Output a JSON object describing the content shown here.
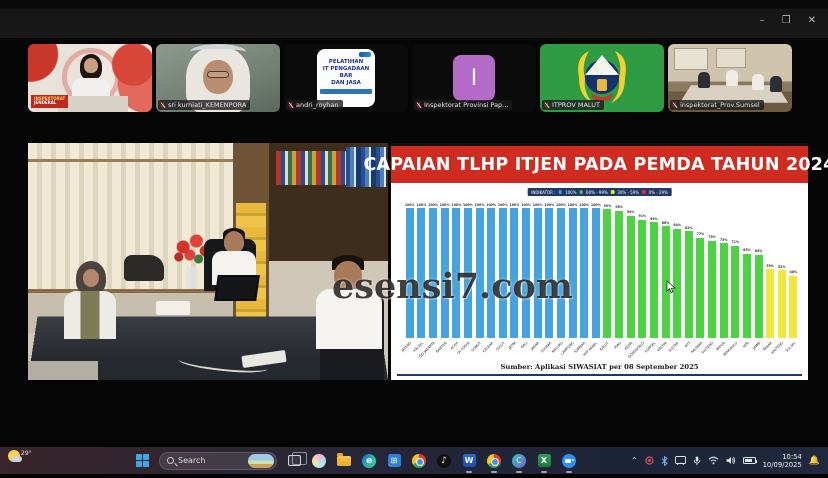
{
  "window": {
    "controls": {
      "minimize": "–",
      "maximize": "❐",
      "close": "✕"
    }
  },
  "participants": [
    {
      "name": "",
      "overlay_logo_line1": "INSPEKTORAT",
      "overlay_logo_line2": "JENDERAL"
    },
    {
      "name": "sri kurniati_KEMENPORA",
      "mic": "muted"
    },
    {
      "name": "andri_royhan",
      "mic": "muted",
      "slide_text": {
        "line1": "PELATIHAN",
        "line2": "IT PENGADAAN BAR",
        "line3": "DAN JASA"
      }
    },
    {
      "name": "Inspektorat Provinsi Pap...",
      "mic": "muted",
      "initial": "I"
    },
    {
      "name": "ITPROV MALUT",
      "mic": "muted"
    },
    {
      "name": "inspektorat_Prov.Sumsel",
      "mic": "muted"
    }
  ],
  "slide": {
    "title": "CAPAIAN TLHP ITJEN PADA PEMDA TAHUN 2024",
    "legend": {
      "label": "INDIKATOR :",
      "items": [
        {
          "color": "#45a3dd",
          "label": "100%"
        },
        {
          "color": "#4cd243",
          "label": "60% - 99%"
        },
        {
          "color": "#f2e53c",
          "label": "30% - 59%"
        },
        {
          "color": "#e03030",
          "label": "0% - 29%"
        }
      ]
    },
    "footer": "Sumber: Aplikasi SIWASIAT per 08 September 2025",
    "banner_color": "#d02b20",
    "accent_navy": "#1f3864"
  },
  "chart_data": {
    "type": "bar",
    "title": "CAPAIAN TLHP ITJEN PADA PEMDA TAHUN 2024",
    "ylim": [
      0,
      100
    ],
    "value_suffix": "%",
    "grid": false,
    "legend_position": "top",
    "categories": [
      "JATENG",
      "KALSEL",
      "DKI JAKARTA",
      "BANTEN",
      "ACEH",
      "DI YOGYA",
      "SUMUT",
      "KALBAR",
      "SULUT",
      "JATIM",
      "BALI",
      "JABAR",
      "SULBAR",
      "MALUKU",
      "LAMPUNG",
      "SUMBAR",
      "KEP BABEL",
      "KALUT",
      "RIAU",
      "KEPRI",
      "GORONTALO",
      "SUMSEL",
      "KALTIM",
      "SULTRA",
      "NTT",
      "KALTARA",
      "SULTENG",
      "PAPUA",
      "BENGKULU",
      "NTB",
      "JAMBI",
      "PABAR",
      "KALTENG",
      "SULSEL"
    ],
    "values": [
      100,
      100,
      100,
      100,
      100,
      100,
      100,
      100,
      100,
      100,
      100,
      100,
      100,
      100,
      100,
      100,
      100,
      99,
      98,
      94,
      91,
      89,
      86,
      84,
      82,
      77,
      75,
      73,
      71,
      65,
      64,
      53,
      52,
      48
    ],
    "bar_colors": [
      "#45a3dd",
      "#45a3dd",
      "#45a3dd",
      "#45a3dd",
      "#45a3dd",
      "#45a3dd",
      "#45a3dd",
      "#45a3dd",
      "#45a3dd",
      "#45a3dd",
      "#45a3dd",
      "#45a3dd",
      "#45a3dd",
      "#45a3dd",
      "#45a3dd",
      "#45a3dd",
      "#45a3dd",
      "#4cd243",
      "#4cd243",
      "#4cd243",
      "#4cd243",
      "#4cd243",
      "#4cd243",
      "#4cd243",
      "#4cd243",
      "#4cd243",
      "#4cd243",
      "#4cd243",
      "#4cd243",
      "#4cd243",
      "#4cd243",
      "#f2e53c",
      "#f2e53c",
      "#f2e53c"
    ]
  },
  "watermark": {
    "text": "esensi7.com"
  },
  "taskbar": {
    "weather": {
      "temp": "29°"
    },
    "search": {
      "label": "Search"
    },
    "icons": [
      "start",
      "search",
      "task-view",
      "copilot",
      "file-explorer",
      "edge",
      "store",
      "chrome",
      "tiktok",
      "word",
      "chrome",
      "canva",
      "excel",
      "zoom"
    ],
    "tray_icons": [
      "chevron-up",
      "record",
      "bluetooth",
      "cast",
      "microphone",
      "wifi",
      "volume",
      "battery",
      "notification-bell"
    ],
    "clock": {
      "time": "10:54",
      "date": "10/09/2025"
    }
  }
}
